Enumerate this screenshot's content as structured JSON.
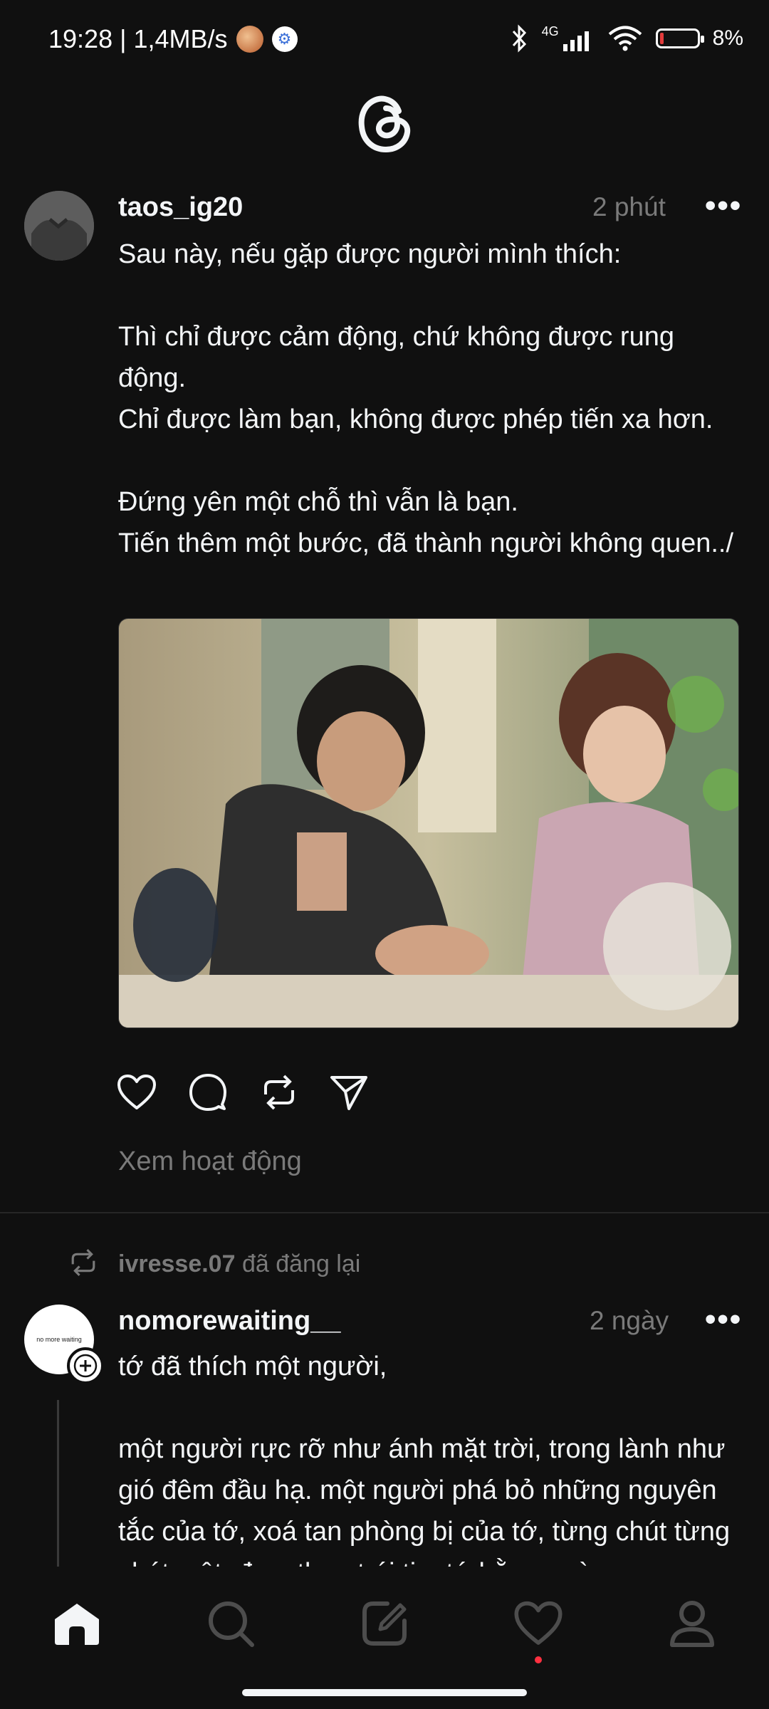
{
  "status_bar": {
    "time_speed": "19:28 | 1,4MB/s",
    "network": "4G",
    "battery_text": "8%",
    "battery_level": 0.08
  },
  "app": {
    "logo_icon": "threads-logo-icon"
  },
  "post1": {
    "username": "taos_ig20",
    "time": "2 phút",
    "more": "•••",
    "text": "Sau này, nếu gặp được người mình thích:\n\nThì chỉ được cảm động, chứ không được rung động.\nChỉ được làm bạn, không được phép tiến xa hơn.\n\nĐứng yên một chỗ thì vẫn là bạn.\nTiến thêm một bước, đã thành người không quen../",
    "activity_link": "Xem hoạt động"
  },
  "post2": {
    "repost_user": "ivresse.07",
    "repost_suffix": " đã đăng lại",
    "username": "nomorewaiting__",
    "avatar_text": "no more waiting",
    "time": "2 ngày",
    "more": "•••",
    "text": "tớ đã thích một người,\n\nmột người rực rỡ như ánh mặt trời, trong lành như gió đêm đầu hạ. một người phá bỏ những nguyên tắc của tớ, xoá tan phòng bị của tớ, từng chút từng chút một, đem theo trái tim tớ hằng ngày"
  },
  "nav": {
    "items": [
      "home-icon",
      "search-icon",
      "compose-icon",
      "activity-heart-icon",
      "profile-icon"
    ],
    "active_index": 0,
    "notification_color": "#ff3040"
  },
  "colors": {
    "background": "#101010",
    "text": "#f3f5f7",
    "muted": "#7a7a7a"
  }
}
